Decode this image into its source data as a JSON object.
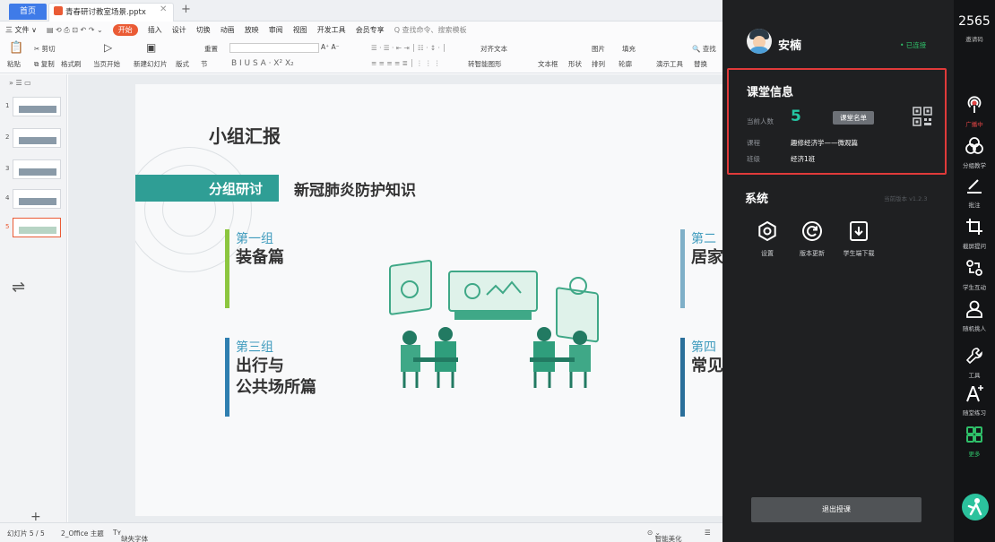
{
  "tabs": {
    "home": "首页",
    "document": "青春研讨教室场景.pptx"
  },
  "ribbon": {
    "file": "三 文件 ∨",
    "menus": [
      "开始",
      "插入",
      "设计",
      "切换",
      "动画",
      "放映",
      "审阅",
      "视图",
      "开发工具",
      "会员专享"
    ],
    "active_menu": "开始",
    "search_cmd": "Q 查找命令、搜索模板",
    "tool_paste": "粘贴",
    "tool_cut": "剪切",
    "tool_copy": "复制",
    "tool_format": "格式刷",
    "tool_from_current": "当页开始",
    "tool_new_slide": "新建幻灯片",
    "tool_layout": "版式",
    "tool_section": "节",
    "tool_reset": "重置",
    "tool_textbox": "文本框",
    "tool_shape": "形状",
    "tool_arrange": "排列",
    "tool_outline": "轮廓",
    "tool_picture": "图片",
    "tool_fill": "填充",
    "tool_present": "演示工具",
    "tool_find": "查找",
    "tool_replace": "替换",
    "tool_align_text": "对齐文本",
    "tool_convert_smart": "转智能图形"
  },
  "thumbnails": [
    "1",
    "2",
    "3",
    "4",
    "5"
  ],
  "slide": {
    "title": "小组汇报",
    "band_label": "分组研讨",
    "subtitle": "新冠肺炎防护知识",
    "groups": [
      {
        "name": "第一组",
        "title_line1": "装备篇",
        "title_line2": ""
      },
      {
        "name": "第三组",
        "title_line1": "出行与",
        "title_line2": "公共场所篇"
      },
      {
        "name": "第二",
        "title_line1": "居家",
        "title_line2": ""
      },
      {
        "name": "第四",
        "title_line1": "常见",
        "title_line2": ""
      }
    ]
  },
  "status": {
    "slide_counter": "幻灯片 5 / 5",
    "theme": "2_Office 主题",
    "missing_font": "缺失字体",
    "smart_beautify": "智能美化"
  },
  "panel": {
    "user_name": "安楠",
    "connection": "• 已连接",
    "class_info_title": "课堂信息",
    "headcount_label": "当前人数",
    "headcount": "5",
    "roster_button": "课堂名单",
    "course_label": "课程",
    "course_value": "趣修经济学——微观篇",
    "class_label": "班级",
    "class_value": "经济1班",
    "system_title": "系统",
    "version": "当前版本 v1.2.3",
    "system_items": [
      "设置",
      "版本更新",
      "学生端下载"
    ],
    "exit_button": "退出授课"
  },
  "strip": {
    "invite_code": "2565",
    "invite_label": "邀请码",
    "items": [
      "广播中",
      "分组教学",
      "批注",
      "截屏提问",
      "学生互动",
      "随机挑人",
      "工具",
      "随堂练习",
      "更多"
    ]
  },
  "colors": {
    "accent_orange": "#ea5b35",
    "teal": "#2f9e95",
    "highlight_red": "#e03a3a",
    "count_green": "#24c6a4",
    "connected_green": "#2fc069",
    "live_red": "#e54545"
  }
}
